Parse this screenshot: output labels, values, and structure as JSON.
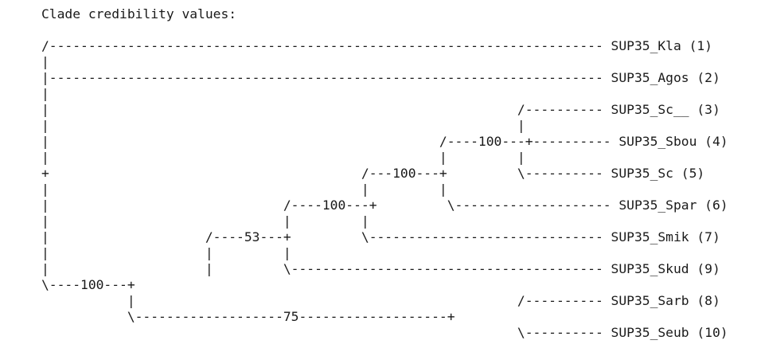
{
  "title": "Clade credibility values:",
  "lines": [
    "",
    "",
    "/----------------------------------------------------------------------- SUP35_Kla (1)",
    "|",
    "|----------------------------------------------------------------------- SUP35_Agos (2)",
    "|",
    "|                                                            /---------- SUP35_Sc__ (3)",
    "|                                                            |",
    "|                                                  /----100---+---------- SUP35_Sbou (4)",
    "|                                                  |         |",
    "+                                        /---100---+         \\---------- SUP35_Sc (5)",
    "|                                        |         |",
    "|                              /----100---+         \\-------------------- SUP35_Spar (6)",
    "|                              |         |",
    "|                    /----53---+         \\------------------------------ SUP35_Smik (7)",
    "|                    |         |",
    "|                    |         \\---------------------------------------- SUP35_Skud (9)",
    "\\----100---+",
    "           |                                                 /---------- SUP35_Sarb (8)",
    "           \\-------------------75-------------------+",
    "                                                             \\---------- SUP35_Seub (10)"
  ]
}
